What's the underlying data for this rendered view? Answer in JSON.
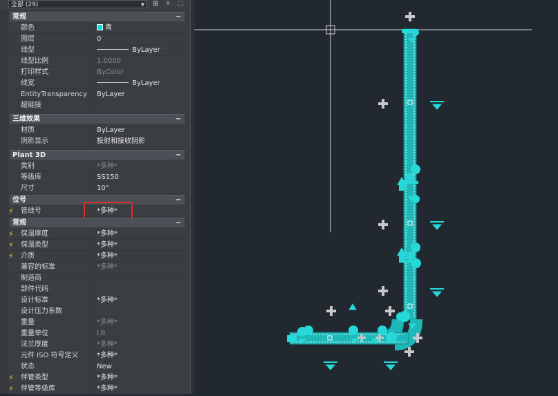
{
  "toolbar": {
    "selection_combo": "全部 (29)",
    "icons": [
      "quick-select-icon",
      "pickadd-icon",
      "select-objects-icon"
    ]
  },
  "sections": {
    "general": {
      "title": "常规",
      "collapse": "−"
    },
    "3d_effects": {
      "title": "三维效果",
      "collapse": "−"
    },
    "plant3d": {
      "title": "Plant 3D",
      "collapse": "−"
    },
    "tag": {
      "title": "位号",
      "collapse": "−"
    },
    "general2": {
      "title": "常规",
      "collapse": "−"
    }
  },
  "rows": {
    "color": {
      "label": "颜色",
      "value": "青",
      "swatch": "#00e0e0"
    },
    "layer": {
      "label": "图层",
      "value": "0"
    },
    "linetype": {
      "label": "线型",
      "value": "ByLayer"
    },
    "linetype_scale": {
      "label": "线型比例",
      "value": "1.0000"
    },
    "plot_style": {
      "label": "打印样式",
      "value": "ByColor"
    },
    "lineweight": {
      "label": "线宽",
      "value": "ByLayer"
    },
    "transparency": {
      "label": "EntityTransparency",
      "value": "ByLayer"
    },
    "hyperlink": {
      "label": "超链接",
      "value": ""
    },
    "material": {
      "label": "材质",
      "value": "ByLayer"
    },
    "shadow": {
      "label": "阴影显示",
      "value": "投射和接收阴影"
    },
    "class": {
      "label": "类别",
      "value": "*多种*"
    },
    "spec": {
      "label": "等级库",
      "value": "SS150"
    },
    "size": {
      "label": "尺寸",
      "value": "10\""
    },
    "line_number": {
      "label": "管线号",
      "value": "*多种*"
    },
    "insul_thickness": {
      "label": "保温厚度",
      "value": "*多种*"
    },
    "insul_type": {
      "label": "保温类型",
      "value": "*多种*"
    },
    "medium": {
      "label": "介质",
      "value": "*多种*"
    },
    "compat_std": {
      "label": "兼容的标准",
      "value": "*多种*"
    },
    "manufacturer": {
      "label": "制造商",
      "value": ""
    },
    "part_code": {
      "label": "部件代码",
      "value": ""
    },
    "design_std": {
      "label": "设计标准",
      "value": "*多种*"
    },
    "design_pressure": {
      "label": "设计压力系数",
      "value": ""
    },
    "weight": {
      "label": "重量",
      "value": "*多种*"
    },
    "weight_unit": {
      "label": "重量单位",
      "value": "LB"
    },
    "flange_thickness": {
      "label": "法兰厚度",
      "value": "*多种*"
    },
    "iso_symbol": {
      "label": "元件 ISO 符号定义",
      "value": "*多种*"
    },
    "status": {
      "label": "状态",
      "value": "New"
    },
    "tracing_type": {
      "label": "伴管类型",
      "value": "*多种*"
    },
    "tracing_spec": {
      "label": "伴管等级库",
      "value": "*多种*"
    }
  },
  "colors": {
    "pipe": "#1fb8b8",
    "pipe_dark": "#0f8f8f",
    "fitting": "#26d8d8",
    "marker": "#bdbdbd",
    "crosshair": "#d8d8d8",
    "viewport_bg": "#212830",
    "highlight": "#d9312b"
  }
}
